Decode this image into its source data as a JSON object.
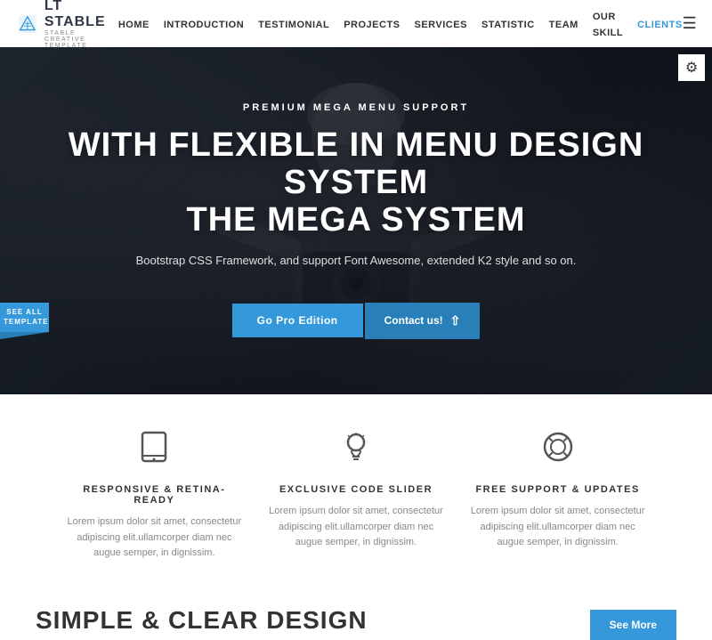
{
  "brand": {
    "title": "LT STABLE",
    "subtitle": "STABLE CREATIVE TEMPLATE"
  },
  "navbar": {
    "links": [
      {
        "label": "HOME",
        "id": "home"
      },
      {
        "label": "INTRODUCTION",
        "id": "introduction"
      },
      {
        "label": "TESTIMONIAL",
        "id": "testimonial"
      },
      {
        "label": "PROJECTS",
        "id": "projects"
      },
      {
        "label": "SERVICES",
        "id": "services"
      },
      {
        "label": "STATISTIC",
        "id": "statistic"
      },
      {
        "label": "TEAM",
        "id": "team"
      },
      {
        "label": "OUR SKILL",
        "id": "ourskill"
      },
      {
        "label": "CLIENTS",
        "id": "clients",
        "active": true
      }
    ]
  },
  "hero": {
    "pretitle": "PREMIUM MEGA MENU SUPPORT",
    "title_line1": "WITH FLEXIBLE IN MENU DESIGN SYSTEM",
    "title_line2": "THE MEGA SYSTEM",
    "subtitle": "Bootstrap CSS Framework, and support Font Awesome, extended K2 style and so on.",
    "btn_pro": "Go Pro Edition",
    "btn_contact": "Contact us!"
  },
  "see_all": "SEE ALL TEMPLATE",
  "gear_icon": "⚙",
  "features": [
    {
      "id": "responsive",
      "title": "RESPONSIVE & RETINA-READY",
      "text": "Lorem ipsum dolor sit amet, consectetur adipiscing elit.ullamcorper diam nec augue semper, in dignissim."
    },
    {
      "id": "code-slider",
      "title": "EXCLUSIVE CODE SLIDER",
      "text": "Lorem ipsum dolor sit amet, consectetur adipiscing elit.ullamcorper diam nec augue semper, in dignissim."
    },
    {
      "id": "support",
      "title": "FREE SUPPORT & UPDATES",
      "text": "Lorem ipsum dolor sit amet, consectetur adipiscing elit.ullamcorper diam nec augue semper, in dignissim."
    }
  ],
  "bottom": {
    "title": "SIMPLE & CLEAR DESIGN",
    "btn_label": "See More"
  }
}
